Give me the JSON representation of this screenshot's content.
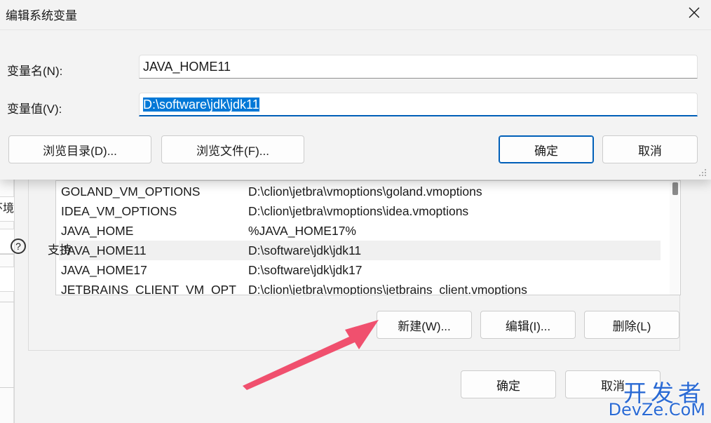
{
  "dialog": {
    "title": "编辑系统变量",
    "name_label": "变量名(N):",
    "name_value": "JAVA_HOME11",
    "value_label": "变量值(V):",
    "value_value": "D:\\software\\jdk\\jdk11",
    "browse_dir_label": "浏览目录(D)...",
    "browse_file_label": "浏览文件(F)...",
    "ok_label": "确定",
    "cancel_label": "取消"
  },
  "background": {
    "left_clip_text": "环境",
    "system_vars": {
      "rows": [
        {
          "name": "GOLAND_VM_OPTIONS",
          "value": "D:\\clion\\jetbra\\vmoptions\\goland.vmoptions",
          "selected": false
        },
        {
          "name": "IDEA_VM_OPTIONS",
          "value": "D:\\clion\\jetbra\\vmoptions\\idea.vmoptions",
          "selected": false
        },
        {
          "name": "JAVA_HOME",
          "value": "%JAVA_HOME17%",
          "selected": false
        },
        {
          "name": "JAVA_HOME11",
          "value": "D:\\software\\jdk\\jdk11",
          "selected": true
        },
        {
          "name": "JAVA_HOME17",
          "value": "D:\\software\\jdk\\jdk17",
          "selected": false
        },
        {
          "name": "JETBRAINS_CLIENT_VM_OPT",
          "value": "D:\\clion\\jetbra\\vmoptions\\jetbrains_client.vmoptions",
          "selected": false
        }
      ],
      "new_label": "新建(W)...",
      "edit_label": "编辑(I)...",
      "delete_label": "删除(L)"
    },
    "ok_label": "确定",
    "cancel_label": "取消",
    "help_icon_glyph": "?",
    "help_text": "支持"
  },
  "watermark": {
    "top": "开发者",
    "bottom": "DevZe.CoM"
  },
  "colors": {
    "accent": "#005fb8",
    "selection": "#0078d7",
    "arrow": "#f0506e",
    "watermark": "#2a6ad4"
  },
  "icons": {
    "close": "close-icon",
    "help": "help-circle-icon",
    "annotation": "arrow-icon",
    "resize": "resize-grip-icon"
  }
}
